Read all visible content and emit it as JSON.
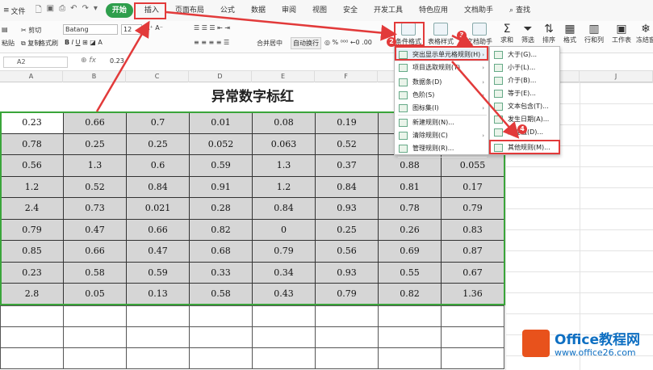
{
  "menubar": {
    "file": "文件",
    "tabs": [
      "开始",
      "插入",
      "页面布局",
      "公式",
      "数据",
      "审阅",
      "视图",
      "安全",
      "开发工具",
      "特色应用",
      "文档助手"
    ],
    "search": "查找"
  },
  "ribbon": {
    "paste": "粘贴",
    "cut": "剪切",
    "copy": "复制",
    "format_painter": "格式刷",
    "font_name": "Batang",
    "font_size": "12",
    "merge_center": "合并居中",
    "wrap_text": "自动换行",
    "conditional_format": "条件格式",
    "table_style": "表格样式",
    "doc_assistant": "文档助手",
    "sum": "求和",
    "filter": "筛选",
    "sort": "排序",
    "format": "格式",
    "rows_cols": "行和列",
    "worksheet": "工作表",
    "freeze": "冻结窗"
  },
  "formula_bar": {
    "cell_ref": "A2",
    "fx": "fx",
    "value": "0.23"
  },
  "columns": [
    "A",
    "B",
    "C",
    "D",
    "E",
    "F",
    "G",
    "H",
    "I",
    "J"
  ],
  "sheet": {
    "title": "异常数字标红",
    "rows": [
      [
        "0.23",
        "0.66",
        "0.7",
        "0.01",
        "0.08",
        "0.19",
        "",
        ""
      ],
      [
        "0.78",
        "0.25",
        "0.25",
        "0.052",
        "0.063",
        "0.52",
        "",
        ""
      ],
      [
        "0.56",
        "1.3",
        "0.6",
        "0.59",
        "1.3",
        "0.37",
        "0.88",
        "0.055"
      ],
      [
        "1.2",
        "0.52",
        "0.84",
        "0.91",
        "1.2",
        "0.84",
        "0.81",
        "0.17"
      ],
      [
        "2.4",
        "0.73",
        "0.021",
        "0.28",
        "0.84",
        "0.93",
        "0.78",
        "0.79"
      ],
      [
        "0.79",
        "0.47",
        "0.66",
        "0.82",
        "0",
        "0.25",
        "0.26",
        "0.83"
      ],
      [
        "0.85",
        "0.66",
        "0.47",
        "0.68",
        "0.79",
        "0.56",
        "0.69",
        "0.87"
      ],
      [
        "0.23",
        "0.58",
        "0.59",
        "0.33",
        "0.34",
        "0.93",
        "0.55",
        "0.67"
      ],
      [
        "2.8",
        "0.05",
        "0.13",
        "0.58",
        "0.43",
        "0.79",
        "0.82",
        "1.36"
      ]
    ]
  },
  "cf_menu": [
    {
      "label": "突出显示单元格规则(H)",
      "arrow": "›"
    },
    {
      "label": "项目选取规则(T)",
      "arrow": "›"
    },
    {
      "label": "数据条(D)",
      "arrow": "›"
    },
    {
      "label": "色阶(S)",
      "arrow": "›"
    },
    {
      "label": "图标集(I)",
      "arrow": "›"
    },
    {
      "label": "新建规则(N)...",
      "arrow": ""
    },
    {
      "label": "清除规则(C)",
      "arrow": "›"
    },
    {
      "label": "管理规则(R)...",
      "arrow": ""
    }
  ],
  "highlight_menu": [
    {
      "label": "大于(G)..."
    },
    {
      "label": "小于(L)..."
    },
    {
      "label": "介于(B)..."
    },
    {
      "label": "等于(E)..."
    },
    {
      "label": "文本包含(T)..."
    },
    {
      "label": "发生日期(A)..."
    },
    {
      "label": "重复值(D)..."
    },
    {
      "label": "其他规则(M)..."
    }
  ],
  "badges": [
    "1",
    "2",
    "3",
    "4"
  ],
  "logo": {
    "line1": "Office教程网",
    "line2": "www.office26.com"
  },
  "colors": {
    "accent_green": "#2e9e4c",
    "highlight_red": "#e23a3a",
    "cell_gray": "#d6d6d6",
    "logo_orange": "#e8521c",
    "logo_blue": "#0e6fc2"
  }
}
